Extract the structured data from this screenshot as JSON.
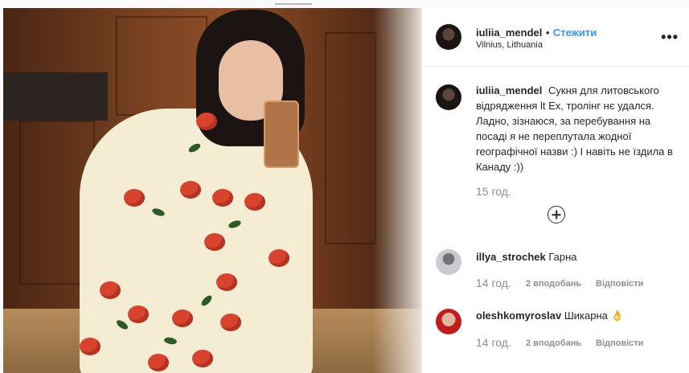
{
  "post": {
    "username": "iuliia_mendel",
    "separator": "•",
    "follow_label": "Стежити",
    "location": "Vilnius, Lithuania",
    "more_icon": "more-options-icon",
    "more_glyph": "•••",
    "caption_username": "iuliia_mendel",
    "caption_text": "Сукня для литовського відрядження lt Ex, тролінг нє удался. Ладно, зізнаюся, за перебування на посаді я не переплутала жодної географічної назви :) І навіть не їздила в Канаду :))",
    "time": "15 год."
  },
  "load_more_icon": "add-circle-icon",
  "comments": [
    {
      "username": "illya_strochek",
      "text": "Гарна",
      "time": "14 год.",
      "likes": "2 вподобань",
      "reply_label": "Відповісти"
    },
    {
      "username": "oleshkomyroslav",
      "text": "Шикарна 👌",
      "time": "14 год.",
      "likes": "2 вподобань",
      "reply_label": "Відповісти"
    }
  ],
  "colors": {
    "accent": "#3897f0",
    "muted": "#8e8e8e",
    "text": "#262626"
  }
}
